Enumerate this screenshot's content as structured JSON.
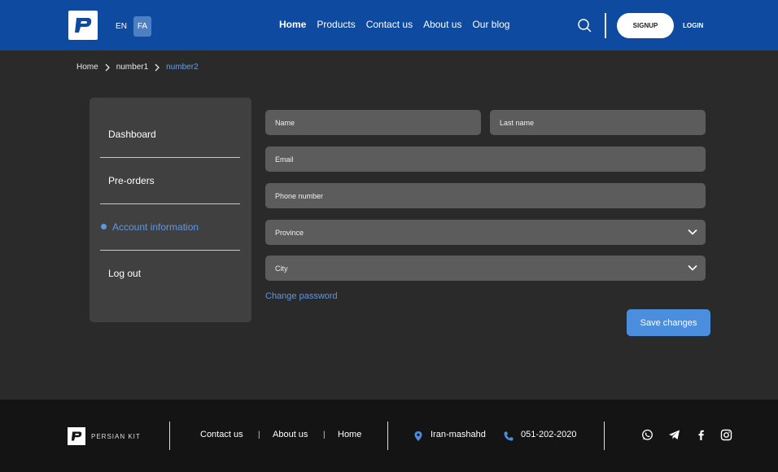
{
  "header": {
    "lang_en": "EN",
    "lang_fa": "FA",
    "nav": [
      "Home",
      "Products",
      "Contact us",
      "About us",
      "Our blog"
    ],
    "signup": "SIGNUP",
    "login": "LOGIN"
  },
  "breadcrumb": [
    "Home",
    "number1",
    "number2"
  ],
  "sidebar": {
    "items": [
      "Dashboard",
      "Pre-orders",
      "Account information",
      "Log out"
    ],
    "active": "Account information"
  },
  "form": {
    "name": "Name",
    "last_name": "Last name",
    "email": "Email",
    "phone": "Phone number",
    "province": "Province",
    "city": "City",
    "change_password": "Change password",
    "save": "Save changes"
  },
  "footer": {
    "brand": "PERSIAN KIT",
    "links": [
      "Contact us",
      "About us",
      "Home"
    ],
    "separator": "|",
    "location": "Iran-mashahd",
    "phone": "051-202-2020"
  },
  "colors": {
    "header_bg": "#0d4aa0",
    "accent": "#4c8ede",
    "page_bg": "#2a2a2a",
    "footer_bg": "#141414"
  }
}
